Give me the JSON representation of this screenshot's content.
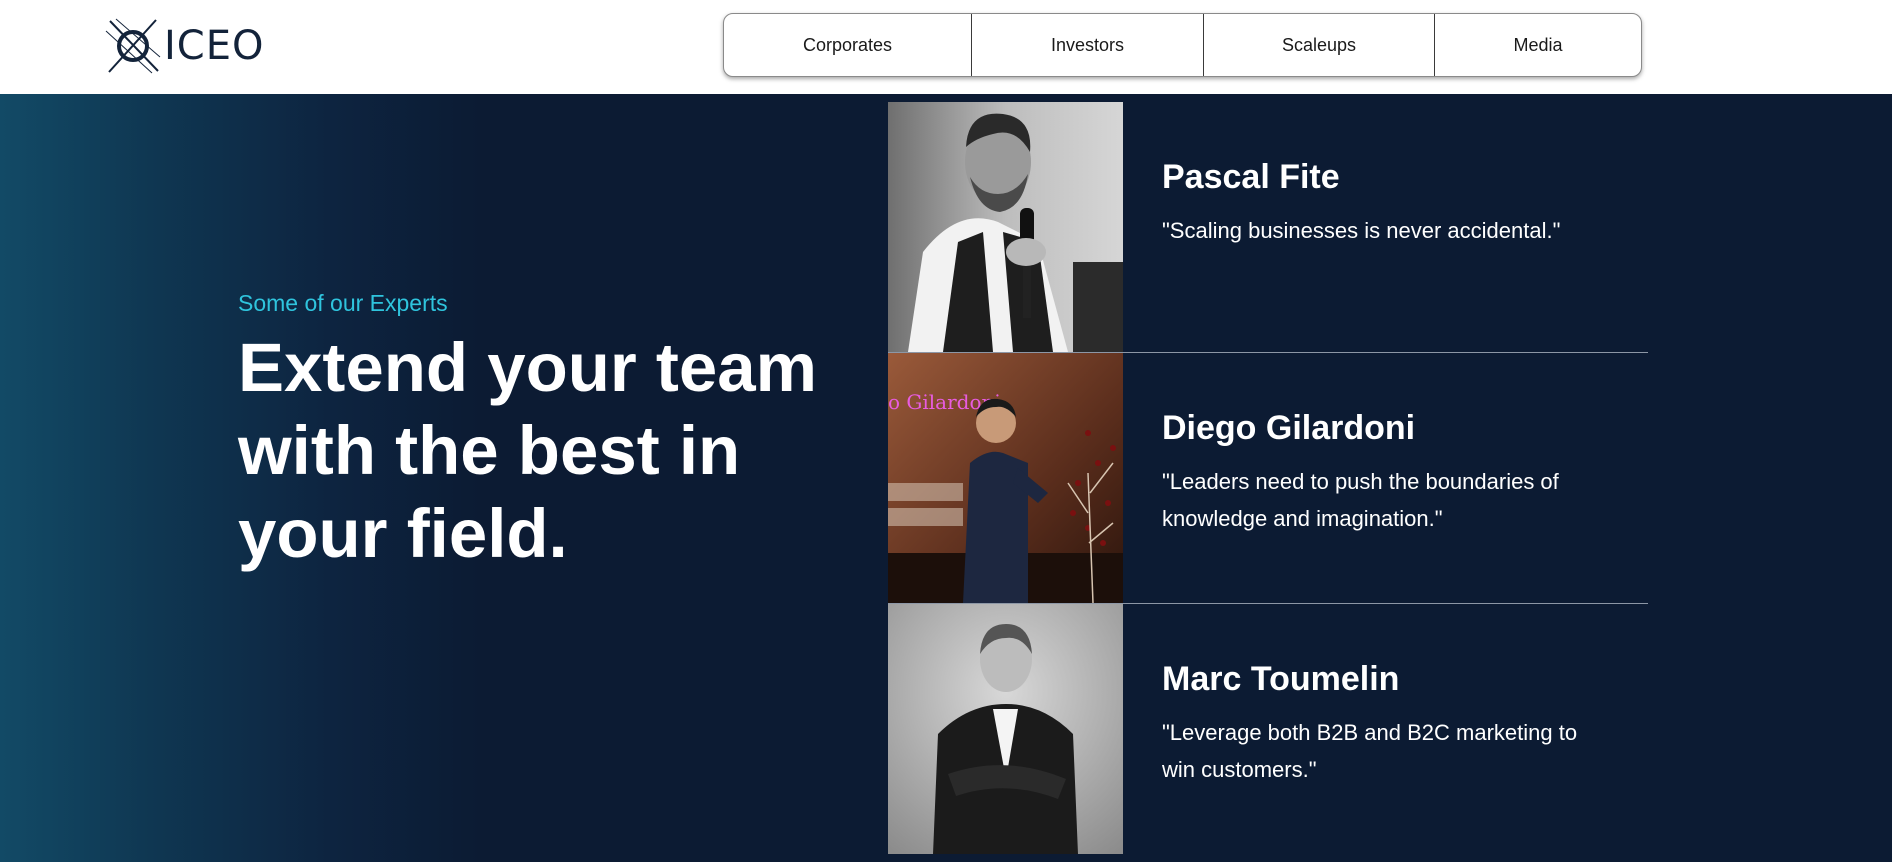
{
  "brand": {
    "name": "ICEO",
    "icon": "iceo-logo-icon"
  },
  "nav": {
    "items": [
      "Corporates",
      "Investors",
      "Scaleups",
      "Media"
    ]
  },
  "hero": {
    "eyebrow": "Some of our Experts",
    "headline": "Extend your team with the best in your field."
  },
  "experts": [
    {
      "name": "Pascal Fite",
      "quote": "\"Scaling businesses is never accidental.\"",
      "photo_icon": "speaker-photo"
    },
    {
      "name": "Diego Gilardoni",
      "quote": "\"Leaders need to push the boundaries of knowledge and imagination.\"",
      "photo_icon": "stage-photo",
      "photo_caption": "o Gilardoni"
    },
    {
      "name": "Marc Toumelin",
      "quote": "\"Leverage both B2B and B2C marketing to win customers.\"",
      "photo_icon": "portrait-photo"
    }
  ],
  "colors": {
    "header_bg": "#ffffff",
    "hero_bg": "#0c1b33",
    "accent": "#2fc4dd",
    "text": "#ffffff"
  }
}
